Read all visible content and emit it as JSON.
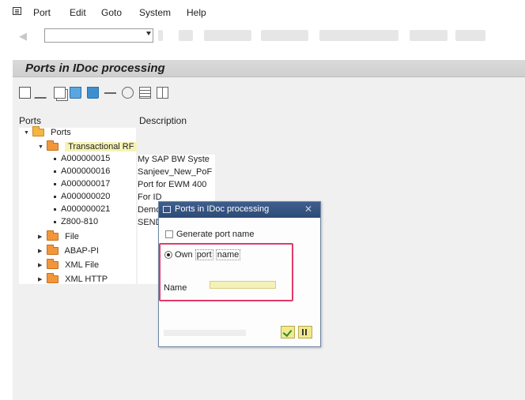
{
  "menubar": {
    "items": [
      "Port",
      "Edit",
      "Goto",
      "System",
      "Help"
    ]
  },
  "toolbar": {
    "command_field_value": ""
  },
  "screen": {
    "title": "Ports in IDoc processing"
  },
  "tree": {
    "headers": {
      "ports": "Ports",
      "description": "Description"
    },
    "root": "Ports",
    "transactional_rfc": "Transactional RF",
    "rfc_ports": [
      {
        "name": "A000000015",
        "description": "My SAP BW Syste"
      },
      {
        "name": "A000000016",
        "description": "Sanjeev_New_PoF"
      },
      {
        "name": "A000000017",
        "description": "Port for EWM 400"
      },
      {
        "name": "A000000020",
        "description": "For ID"
      },
      {
        "name": "A000000021",
        "description": "Demo"
      },
      {
        "name": "Z800-810",
        "description": "SEND"
      }
    ],
    "other_folders": [
      "File",
      "ABAP-PI",
      "XML File",
      "XML HTTP"
    ]
  },
  "dialog": {
    "title": "Ports in IDoc processing",
    "generate_port_name": "Generate port name",
    "own_port_name_parts": [
      "Own",
      "port",
      "name"
    ],
    "name_label": "Name",
    "name_value": ""
  },
  "icons": [
    "menu-icon",
    "back-icon",
    "create-icon",
    "change-icon",
    "copy-icon",
    "delete-icon",
    "where-used-icon",
    "arrow-icon",
    "network-icon",
    "list-icon",
    "grid-icon",
    "ok-icon",
    "cancel-icon"
  ],
  "colors": {
    "dialog_titlebar": "#2d4a76",
    "highlight_frame": "#e23a6a",
    "folder": "#f6b543"
  }
}
